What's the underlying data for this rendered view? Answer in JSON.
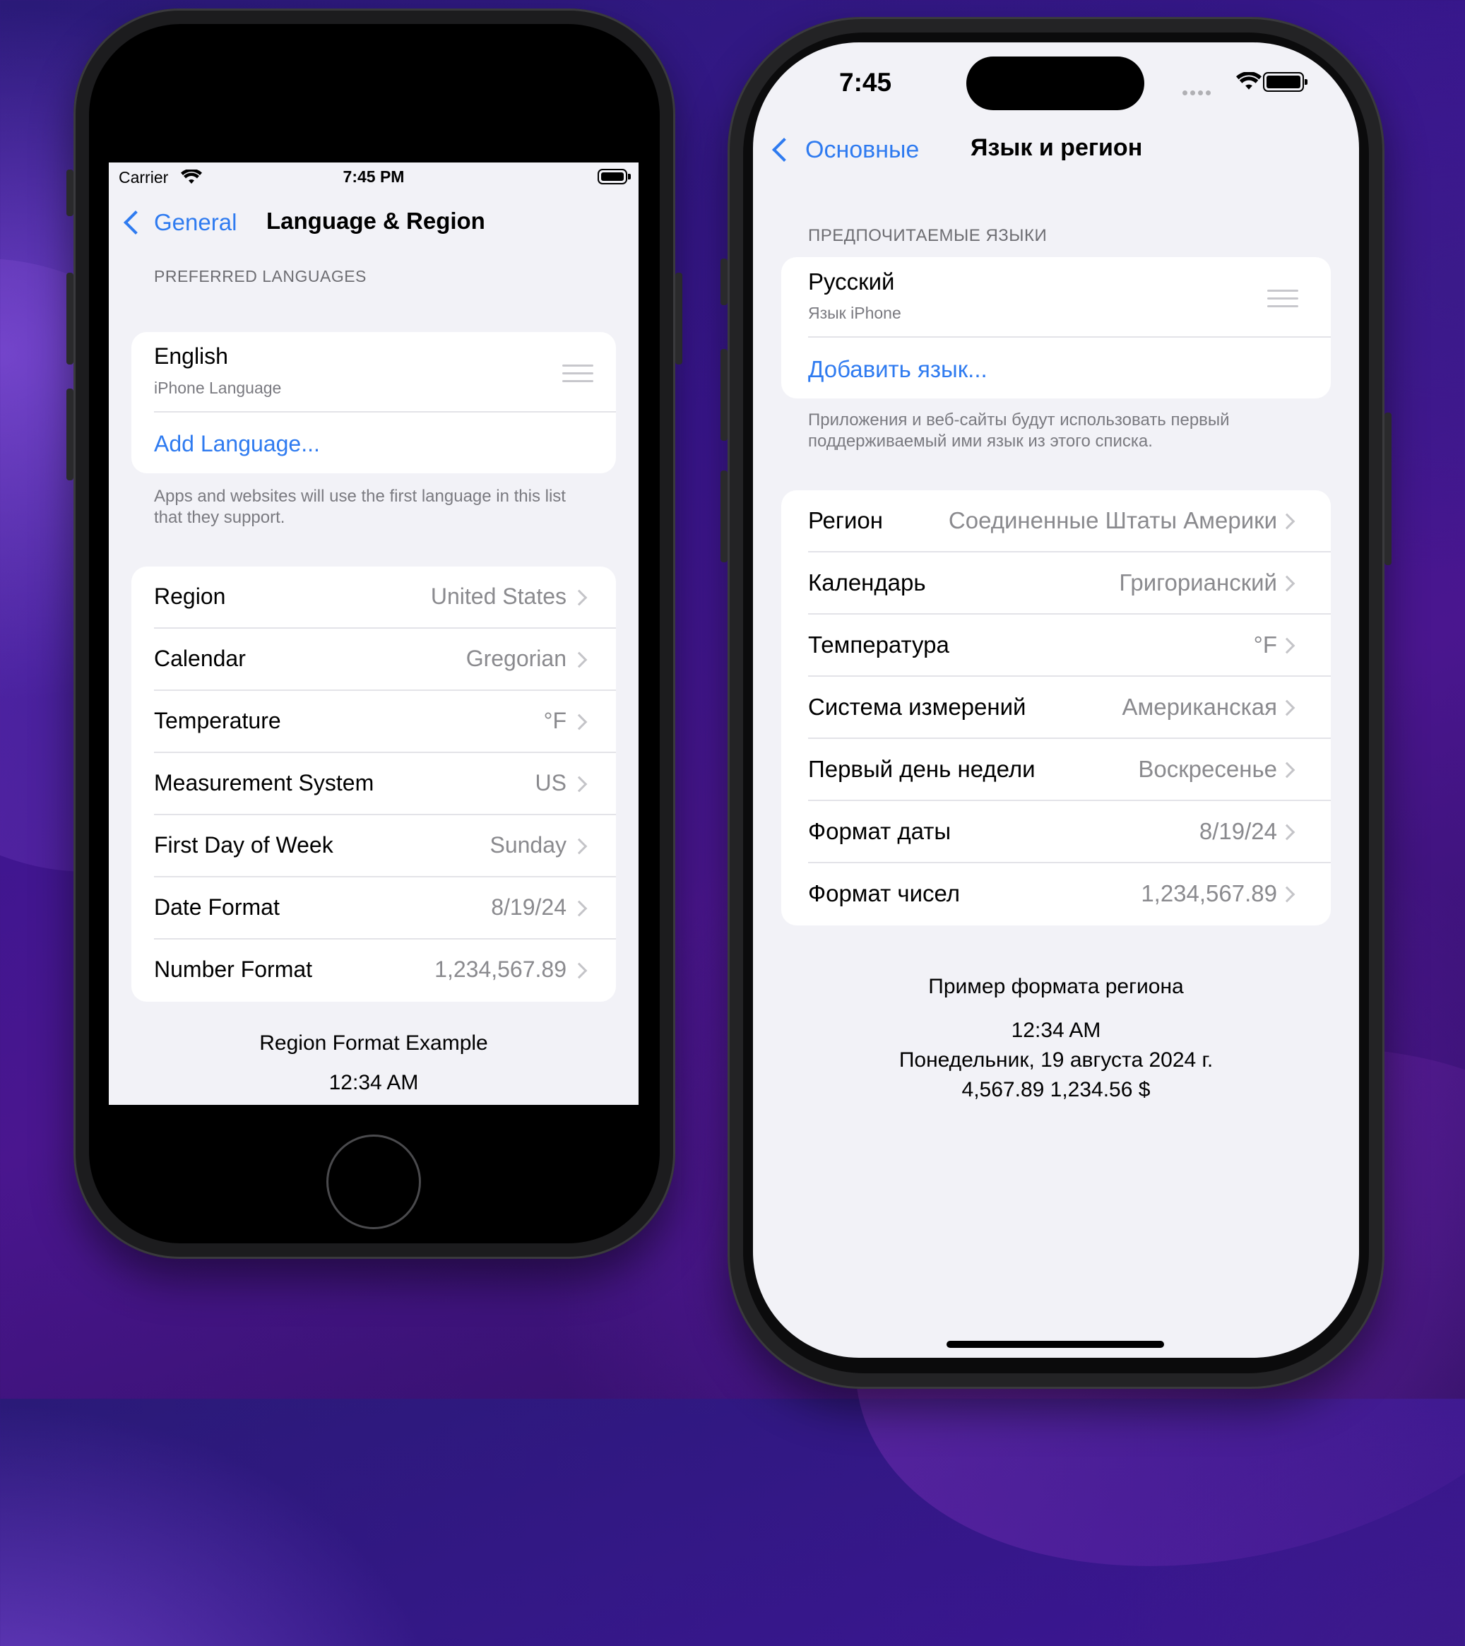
{
  "left_phone": {
    "status": {
      "carrier": "Carrier",
      "time": "7:45 PM"
    },
    "nav": {
      "back": "General",
      "title": "Language & Region"
    },
    "preferred_header": "PREFERRED LANGUAGES",
    "language": {
      "name": "English",
      "sub": "iPhone Language"
    },
    "add_language": "Add Language...",
    "footer": "Apps and websites will use the first language in this list that they support.",
    "rows": [
      {
        "label": "Region",
        "value": "United States"
      },
      {
        "label": "Calendar",
        "value": "Gregorian"
      },
      {
        "label": "Temperature",
        "value": "°F"
      },
      {
        "label": "Measurement System",
        "value": "US"
      },
      {
        "label": "First Day of Week",
        "value": "Sunday"
      },
      {
        "label": "Date Format",
        "value": "8/19/24"
      },
      {
        "label": "Number Format",
        "value": "1,234,567.89"
      }
    ],
    "example_title": "Region Format Example",
    "example_time": "12:34 AM"
  },
  "right_phone": {
    "status": {
      "time": "7:45"
    },
    "nav": {
      "back": "Основные",
      "title": "Язык и регион"
    },
    "preferred_header": "ПРЕДПОЧИТАЕМЫЕ ЯЗЫКИ",
    "language": {
      "name": "Русский",
      "sub": "Язык iPhone"
    },
    "add_language": "Добавить язык...",
    "footer": "Приложения и веб-сайты будут использовать первый поддерживаемый ими язык из этого списка.",
    "rows": [
      {
        "label": "Регион",
        "value": "Соединенные Штаты Америки"
      },
      {
        "label": "Календарь",
        "value": "Григорианский"
      },
      {
        "label": "Температура",
        "value": "°F"
      },
      {
        "label": "Система измерений",
        "value": "Американская"
      },
      {
        "label": "Первый день недели",
        "value": "Воскресенье"
      },
      {
        "label": "Формат даты",
        "value": "8/19/24"
      },
      {
        "label": "Формат чисел",
        "value": "1,234,567.89"
      }
    ],
    "example_title": "Пример формата региона",
    "example_time": "12:34 AM",
    "example_date": "Понедельник, 19 августа 2024 г.",
    "example_numbers": "4,567.89 1,234.56 $"
  },
  "colors": {
    "accent": "#2f7bf0",
    "background": "#f2f2f7",
    "secondary_text": "#8a8a8e"
  },
  "icons": [
    "wifi-icon",
    "battery-icon",
    "chevron-left-icon",
    "chevron-right-icon",
    "drag-handle-icon",
    "cellular-dots-icon"
  ]
}
